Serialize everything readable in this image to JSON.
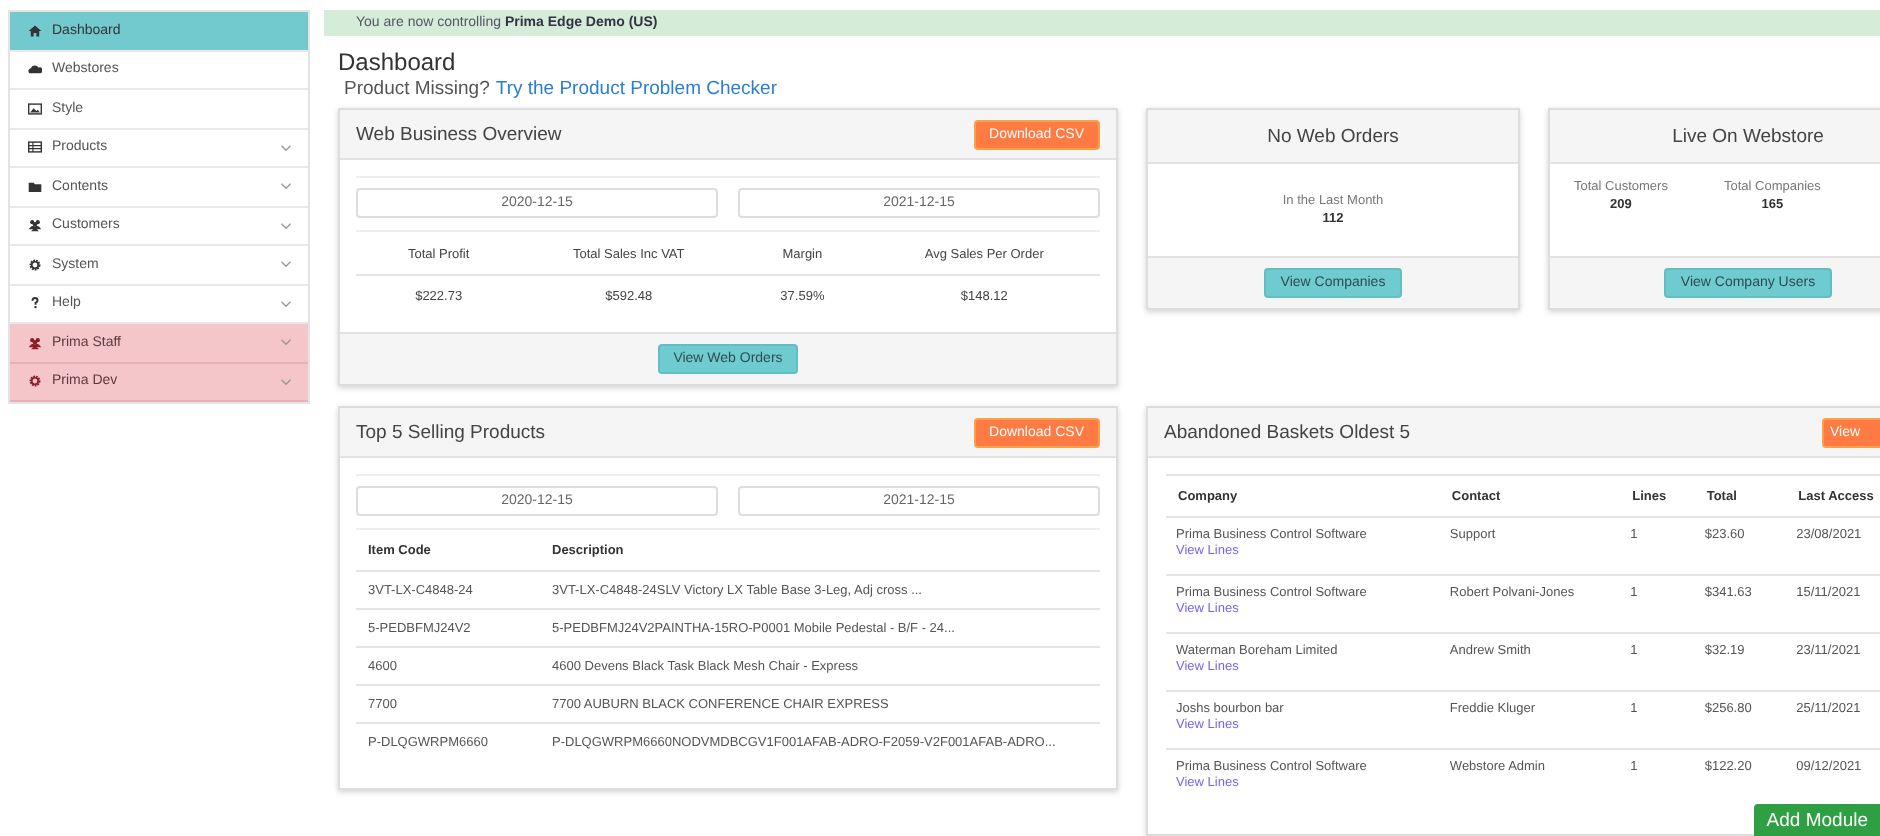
{
  "sidebar": {
    "items": [
      {
        "label": "Dashboard",
        "selected": true,
        "expandable": false,
        "highlighted": false
      },
      {
        "label": "Webstores",
        "selected": false,
        "expandable": false,
        "highlighted": false
      },
      {
        "label": "Style",
        "selected": false,
        "expandable": false,
        "highlighted": false
      },
      {
        "label": "Products",
        "selected": false,
        "expandable": true,
        "highlighted": false
      },
      {
        "label": "Contents",
        "selected": false,
        "expandable": true,
        "highlighted": false
      },
      {
        "label": "Customers",
        "selected": false,
        "expandable": true,
        "highlighted": false
      },
      {
        "label": "System",
        "selected": false,
        "expandable": true,
        "highlighted": false
      },
      {
        "label": "Help",
        "selected": false,
        "expandable": true,
        "highlighted": false
      },
      {
        "label": "Prima Staff",
        "selected": false,
        "expandable": true,
        "highlighted": true
      },
      {
        "label": "Prima Dev",
        "selected": false,
        "expandable": true,
        "highlighted": true
      }
    ]
  },
  "alert": {
    "text": "You are now controlling **Prima Edge Demo (US)**"
  },
  "page_title": "Dashboard",
  "product_missing": {
    "text": "Product Missing?",
    "link": "Try the Product Problem Checker"
  },
  "web_business_overview": {
    "title": "Web Business Overview",
    "download_button": "Download CSV",
    "date_from": "2020-12-15",
    "date_to": "2021-12-15",
    "columns": [
      "Total Profit",
      "Total Sales Inc VAT",
      "Margin",
      "Avg Sales Per Order"
    ],
    "values": [
      "$222.73",
      "$592.48",
      "37.59%",
      "$148.12"
    ],
    "button": "View Web Orders"
  },
  "no_web_orders": {
    "title": "No Web Orders",
    "label": "In the Last Month",
    "value": "112",
    "button": "View Companies"
  },
  "live_on_webstore": {
    "title": "Live On Webstore",
    "stats": [
      {
        "label": "Total Customers",
        "value": "209"
      },
      {
        "label": "Total Companies",
        "value": "165"
      }
    ],
    "button": "View Company Users"
  },
  "top_selling": {
    "title": "Top 5 Selling Products",
    "download_button": "Download CSV",
    "date_from": "2020-12-15",
    "date_to": "2021-12-15",
    "columns": [
      "Item Code",
      "Description"
    ],
    "rows": [
      [
        "3VT-LX-C4848-24",
        "3VT-LX-C4848-24SLV Victory LX Table Base 3-Leg, Adj cross ..."
      ],
      [
        "5-PEDBFMJ24V2",
        "5-PEDBFMJ24V2PAINTHA-15RO-P0001 Mobile Pedestal - B/F - 24..."
      ],
      [
        "4600",
        "4600 Devens Black Task Black Mesh Chair - Express"
      ],
      [
        "7700",
        "7700 AUBURN BLACK CONFERENCE CHAIR EXPRESS"
      ],
      [
        "P-DLQGWRPM6660",
        "P-DLQGWRPM6660NODVMDBCGV1F001AFAB-ADRO-F2059-V2F001AFAB-ADRO..."
      ]
    ]
  },
  "abandoned_baskets": {
    "title": "Abandoned Baskets Oldest 5",
    "view_button": "View",
    "columns": [
      "Company",
      "Contact",
      "Lines",
      "Total",
      "Last Access"
    ],
    "rows": [
      {
        "company": "Prima Business Control Software",
        "link": "View Lines",
        "contact": "Support",
        "lines": "1",
        "total": "$23.60",
        "last_access": "23/08/2021"
      },
      {
        "company": "Prima Business Control Software",
        "link": "View Lines",
        "contact": "Robert Polvani-Jones",
        "lines": "1",
        "total": "$341.63",
        "last_access": "15/11/2021"
      },
      {
        "company": "Waterman Boreham Limited",
        "link": "View Lines",
        "contact": "Andrew Smith",
        "lines": "1",
        "total": "$32.19",
        "last_access": "23/11/2021"
      },
      {
        "company": "Joshs bourbon bar",
        "link": "View Lines",
        "contact": "Freddie Kluger",
        "lines": "1",
        "total": "$256.80",
        "last_access": "25/11/2021"
      },
      {
        "company": "Prima Business Control Software",
        "link": "View Lines",
        "contact": "Webstore Admin",
        "lines": "1",
        "total": "$122.20",
        "last_access": "09/12/2021"
      }
    ]
  },
  "add_module_button": "Add Module"
}
